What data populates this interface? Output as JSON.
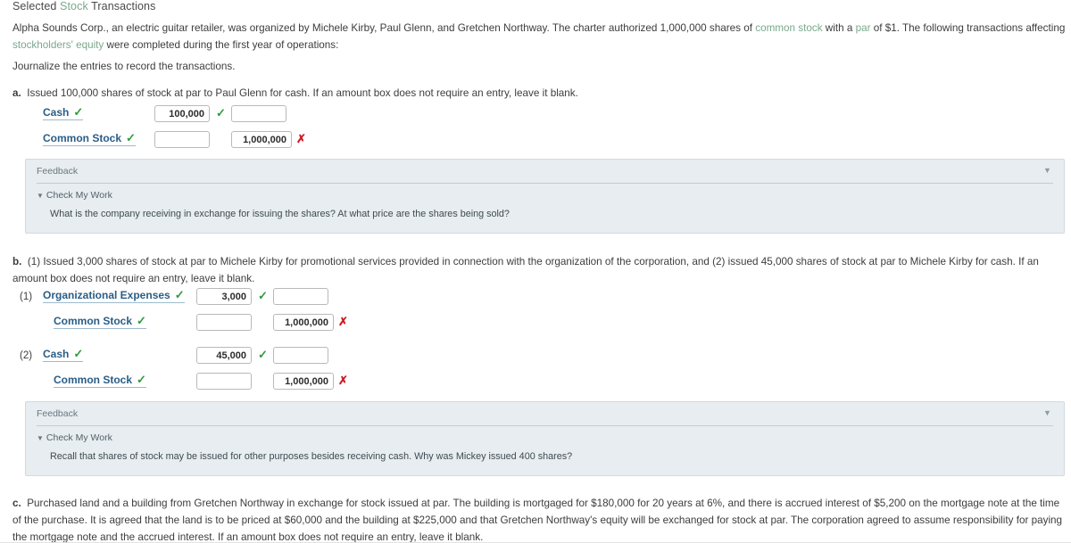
{
  "header": {
    "title_pre": "Selected ",
    "title_link": "Stock",
    "title_post": " Transactions"
  },
  "intro": {
    "seg1": "Alpha Sounds Corp., an electric guitar retailer, was organized by Michele Kirby, Paul Glenn, and Gretchen Northway. The charter authorized 1,000,000 shares of ",
    "link1": "common stock",
    "seg2": " with a ",
    "link2": "par",
    "seg3": " of $1. The following transactions affecting ",
    "link3": "stockholders' equity",
    "seg4": " were completed during the first year of operations:"
  },
  "instruction": "Journalize the entries to record the transactions.",
  "parts": {
    "a": {
      "label": "a.",
      "text": "Issued 100,000 shares of stock at par to Paul Glenn for cash. If an amount box does not require an entry, leave it blank.",
      "rows": [
        {
          "num": "",
          "account": "Cash",
          "account_check": "✓",
          "debit": "100,000",
          "debit_mark": "✓",
          "debit_mark_state": "ok",
          "credit": "",
          "credit_mark": "",
          "credit_mark_state": ""
        },
        {
          "num": "",
          "account": "Common Stock",
          "account_check": "✓",
          "debit": "",
          "debit_mark": "",
          "debit_mark_state": "",
          "credit": "1,000,000",
          "credit_mark": "✗",
          "credit_mark_state": "bad"
        }
      ],
      "feedback": {
        "heading": "Feedback",
        "check_my_work": "Check My Work",
        "body": "What is the company receiving in exchange for issuing the shares? At what price are the shares being sold?",
        "collapse_icon": "▼",
        "expand_icon": "▼"
      }
    },
    "b": {
      "label": "b.",
      "text": "(1) Issued 3,000 shares of stock at par to Michele Kirby for promotional services provided in connection with the organization of the corporation, and (2) issued 45,000 shares of stock at par to Michele Kirby for cash. If an amount box does not require an entry, leave it blank.",
      "rows": [
        {
          "num": "(1)",
          "account": "Organizational Expenses",
          "account_check": "✓",
          "debit": "3,000",
          "debit_mark": "✓",
          "debit_mark_state": "ok",
          "credit": "",
          "credit_mark": "",
          "credit_mark_state": ""
        },
        {
          "num": "",
          "account": "Common Stock",
          "account_check": "✓",
          "debit": "",
          "debit_mark": "",
          "debit_mark_state": "",
          "credit": "1,000,000",
          "credit_mark": "✗",
          "credit_mark_state": "bad"
        },
        {
          "num": "(2)",
          "account": "Cash",
          "account_check": "✓",
          "debit": "45,000",
          "debit_mark": "✓",
          "debit_mark_state": "ok",
          "credit": "",
          "credit_mark": "",
          "credit_mark_state": ""
        },
        {
          "num": "",
          "account": "Common Stock",
          "account_check": "✓",
          "debit": "",
          "debit_mark": "",
          "debit_mark_state": "",
          "credit": "1,000,000",
          "credit_mark": "✗",
          "credit_mark_state": "bad"
        }
      ],
      "feedback": {
        "heading": "Feedback",
        "check_my_work": "Check My Work",
        "body": "Recall that shares of stock may be issued for other purposes besides receiving cash. Why was Mickey issued 400 shares?",
        "collapse_icon": "▼",
        "expand_icon": "▼"
      }
    },
    "c": {
      "label": "c.",
      "text": "Purchased land and a building from Gretchen Northway in exchange for stock issued at par. The building is mortgaged for $180,000 for 20 years at 6%, and there is accrued interest of $5,200 on the mortgage note at the time of the purchase. It is agreed that the land is to be priced at $60,000 and the building at $225,000 and that Gretchen Northway's equity will be exchanged for stock at par. The corporation agreed to assume responsibility for paying the mortgage note and the accrued interest. If an amount box does not require an entry, leave it blank."
    }
  },
  "colors": {
    "link_green": "#7ba98c",
    "account_blue": "#2a5d86",
    "check_green": "#2e9b3f",
    "cross_red": "#cc1b24",
    "feedback_bg": "#e7edf0"
  },
  "input_placeholder": ""
}
